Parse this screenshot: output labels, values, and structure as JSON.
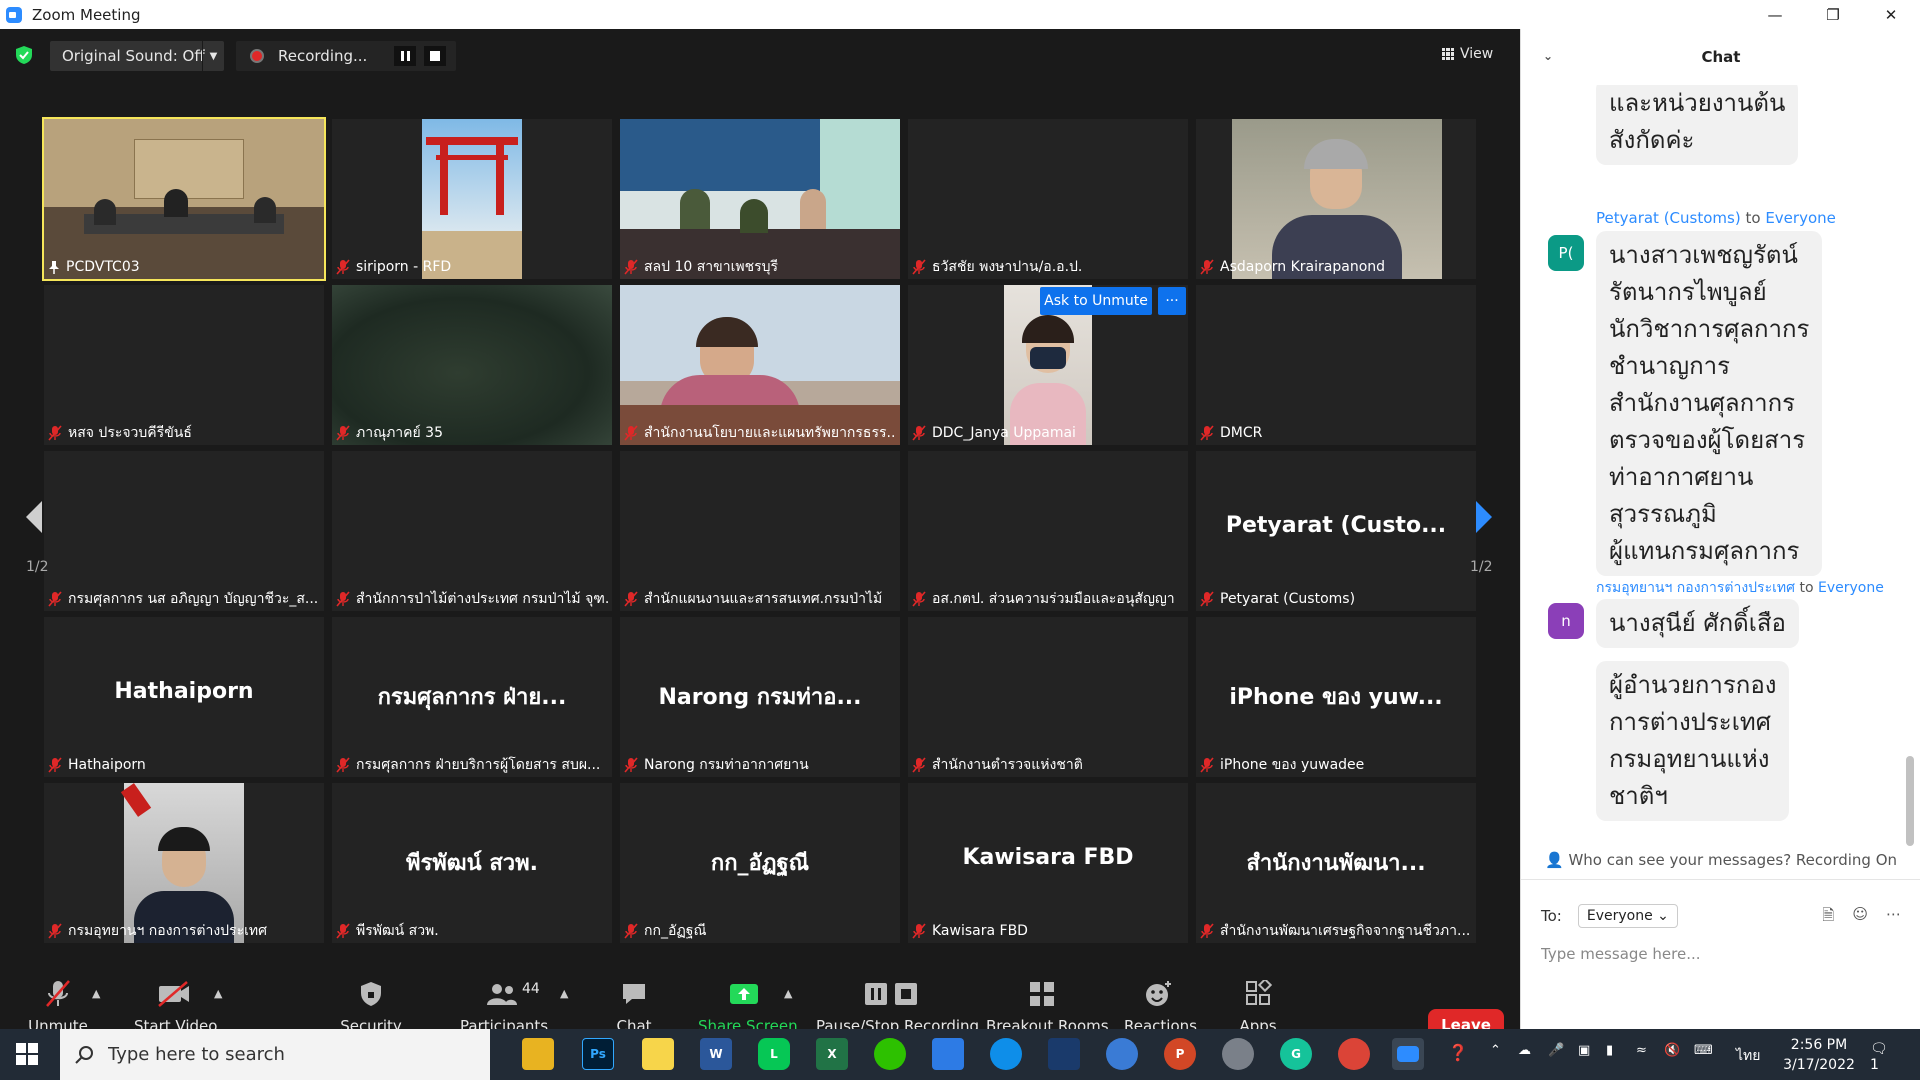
{
  "window": {
    "title": "Zoom Meeting"
  },
  "topbar": {
    "original_sound": "Original Sound: Off",
    "recording_label": "Recording...",
    "view_label": "View"
  },
  "tiles": [
    {
      "name": "PCDVTC03",
      "big": "",
      "video": "room",
      "active": true,
      "pin": true
    },
    {
      "name": "siriporn - RFD",
      "big": "",
      "video": "torii"
    },
    {
      "name": "สลป 10 สาขาเพชรบุรี",
      "big": "",
      "video": "office"
    },
    {
      "name": "ธวัสชัย พงษาปาน/อ.อ.ป.",
      "big": "",
      "video": "dark"
    },
    {
      "name": "Asdaporn Krairapanond",
      "big": "",
      "video": "woman"
    },
    {
      "name": "หสจ ประจวบคีรีขันธ์",
      "big": "",
      "video": "dark"
    },
    {
      "name": "ภาณุภาคย์ 35",
      "big": "",
      "video": "blur"
    },
    {
      "name": "สำนักงานนโยบายและแผนทรัพยากรธรร...",
      "big": "",
      "video": "desk"
    },
    {
      "name": "DDC_Janya Uppamai",
      "big": "",
      "video": "janya",
      "ask": true
    },
    {
      "name": "DMCR",
      "big": "",
      "video": "dark"
    },
    {
      "name": "กรมศุลกากร นส อภิญญา บัญญาชีวะ_ส...",
      "big": "",
      "video": "dark"
    },
    {
      "name": "สำนักการป่าไม้ต่างประเทศ กรมป่าไม้ จุฑ...",
      "big": "",
      "video": "dark"
    },
    {
      "name": "สำนักแผนงานและสารสนเทศ.กรมป่าไม้",
      "big": "",
      "video": "dark"
    },
    {
      "name": "อส.กตป. ส่วนความร่วมมือและอนุสัญญา",
      "big": "",
      "video": "dark"
    },
    {
      "name": "Petyarat (Customs)",
      "big": "Petyarat  (Custo...",
      "video": "none"
    },
    {
      "name": "Hathaiporn",
      "big": "Hathaiporn",
      "video": "none"
    },
    {
      "name": "กรมศุลกากร ฝ่ายบริการผู้โดยสาร สบผ...",
      "big": "กรมศุลกากร ฝ่าย...",
      "video": "none"
    },
    {
      "name": "Narong กรมท่าอากาศยาน",
      "big": "Narong กรมท่าอ...",
      "video": "none"
    },
    {
      "name": "สำนักงานตำรวจแห่งชาติ",
      "big": "",
      "video": "dark"
    },
    {
      "name": "iPhone ของ yuwadee",
      "big": "iPhone ของ yuw...",
      "video": "none"
    },
    {
      "name": "กรมอุทยานฯ กองการต่างประเทศ",
      "big": "",
      "video": "portrait"
    },
    {
      "name": "พีรพัฒน์ สวพ.",
      "big": "พีรพัฒน์ สวพ.",
      "video": "none"
    },
    {
      "name": "กก_อัฏฐณี",
      "big": "กก_อัฏฐณี",
      "video": "none"
    },
    {
      "name": "Kawisara FBD",
      "big": "Kawisara FBD",
      "video": "none"
    },
    {
      "name": "สำนักงานพัฒนาเศรษฐกิจจากฐานชีวภา...",
      "big": "สำนักงานพัฒนา...",
      "video": "none"
    }
  ],
  "tile_overlay": {
    "ask_unmute": "Ask to Unmute",
    "more": "···"
  },
  "pager": {
    "left": "1/2",
    "right": "1/2"
  },
  "toolbar": {
    "unmute": "Unmute",
    "start_video": "Start Video",
    "security": "Security",
    "participants": "Participants",
    "participants_count": "44",
    "chat": "Chat",
    "share_screen": "Share Screen",
    "pause_stop": "Pause/Stop Recording",
    "breakout": "Breakout Rooms",
    "reactions": "Reactions",
    "apps": "Apps",
    "leave": "Leave"
  },
  "chat": {
    "title": "Chat",
    "msg0_lines": [
      "และหน่วยงานต้น",
      "สังกัดค่ะ"
    ],
    "msg1_sender": "Petyarat (Customs)",
    "msg1_to_word": "to",
    "msg1_to": "Everyone",
    "msg1_avatar": "P(",
    "msg1_lines": [
      "นางสาวเพชญรัตน์",
      "รัตนากรไพบูลย์",
      "นักวิชาการศุลกากร",
      "ชำนาญการ",
      "สำนักงานศุลกากร",
      "ตรวจของผู้โดยสาร",
      "ท่าอากาศยาน",
      "สุวรรณภูมิ",
      "ผู้แทนกรมศุลกากร"
    ],
    "msg2_sender": "กรมอุทยานฯ กองการต่างประเทศ",
    "msg2_to_word": "to",
    "msg2_to": "Everyone",
    "msg2_avatar": "n",
    "msg2_lines": [
      "นางสุนีย์ ศักดิ์เสือ"
    ],
    "msg3_lines": [
      "ผู้อำนวยการกอง",
      "การต่างประเทศ",
      "กรมอุทยานแห่ง",
      "ชาติฯ"
    ],
    "who_can_see": "Who can see your messages? Recording On",
    "to_label": "To:",
    "to_value": "Everyone",
    "placeholder": "Type message here..."
  },
  "taskbar": {
    "search_placeholder": "Type here to search",
    "lang": "ไทย",
    "time": "2:56 PM",
    "date": "3/17/2022",
    "notif_count": "1"
  },
  "colors": {
    "accent": "#2d8cff",
    "leave": "#e02828",
    "share": "#23d959",
    "active_tile": "#f6e65a",
    "mute_red": "#e02828"
  }
}
